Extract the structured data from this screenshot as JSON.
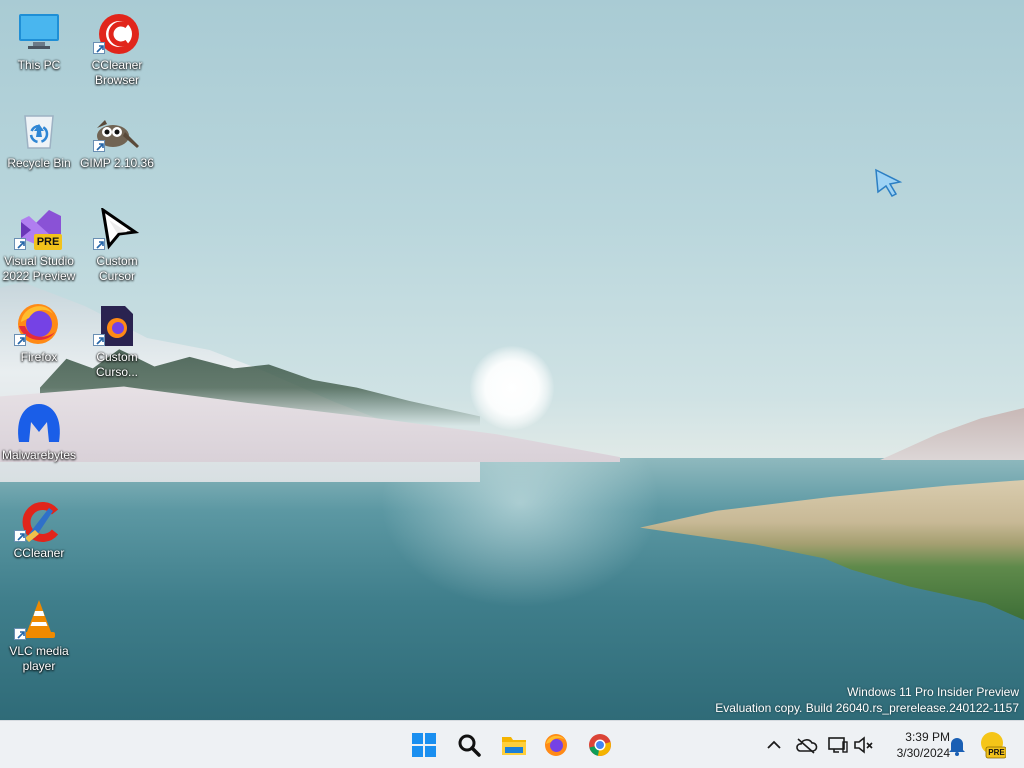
{
  "desktop": {
    "icons": [
      {
        "id": "this-pc",
        "label": "This PC"
      },
      {
        "id": "ccleaner-browser",
        "label": "CCleaner\nBrowser"
      },
      {
        "id": "recycle-bin",
        "label": "Recycle Bin"
      },
      {
        "id": "gimp",
        "label": "GIMP 2.10.36"
      },
      {
        "id": "visual-studio",
        "label": "Visual Studio\n2022 Preview",
        "badge": "PRE"
      },
      {
        "id": "custom-cursor",
        "label": "Custom\nCursor"
      },
      {
        "id": "firefox",
        "label": "Firefox"
      },
      {
        "id": "custom-cursor-2",
        "label": "Custom\nCurso..."
      },
      {
        "id": "malwarebytes",
        "label": "Malwarebytes"
      },
      {
        "id": "ccleaner",
        "label": "CCleaner"
      },
      {
        "id": "vlc",
        "label": "VLC media\nplayer"
      }
    ],
    "watermark": {
      "line1": "Windows 11 Pro Insider Preview",
      "line2": "Evaluation copy. Build 26040.rs_prerelease.240122-1157"
    }
  },
  "taskbar": {
    "pinned": [
      "start-icon",
      "search-icon",
      "file-explorer-icon",
      "firefox-icon",
      "chrome-icon"
    ],
    "tray": {
      "icons": [
        "chevron-up-icon",
        "onedrive-offline-icon",
        "network-icon",
        "volume-muted-icon"
      ],
      "time": "3:39 PM",
      "date": "3/30/2024",
      "notification_badge": "PRE"
    }
  },
  "colors": {
    "accent": "#0a64c8",
    "taskbar_bg": "#eef1f4"
  }
}
